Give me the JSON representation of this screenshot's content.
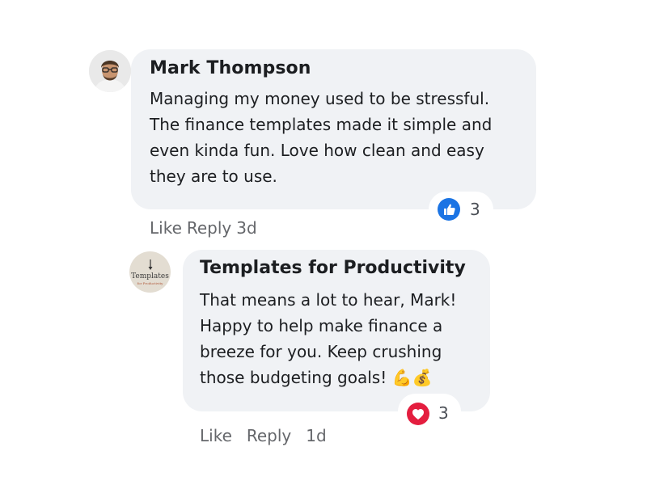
{
  "comments": [
    {
      "author": "Mark Thompson",
      "lines": [
        "Managing my money used to be stressful.",
        "The finance templates made it simple and",
        "even kinda fun. Love how clean and easy",
        "they are to use."
      ],
      "reaction": {
        "icon": "like-icon",
        "count": "3",
        "color": "#1b74e4"
      },
      "actions": {
        "like": "Like",
        "reply": "Reply",
        "time": "3d"
      }
    },
    {
      "author": "Templates for Productivity",
      "avatar_logo_text": "Templates",
      "avatar_logo_sub": "for Productivity",
      "lines": [
        "That means a lot to hear, Mark!",
        "Happy to help make finance a",
        "breeze for you. Keep crushing",
        "those budgeting goals! 💪💰"
      ],
      "reaction": {
        "icon": "heart-icon",
        "count": "3",
        "color": "#e41e3f"
      },
      "actions": {
        "like": "Like",
        "reply": "Reply",
        "time": "1d"
      }
    }
  ]
}
